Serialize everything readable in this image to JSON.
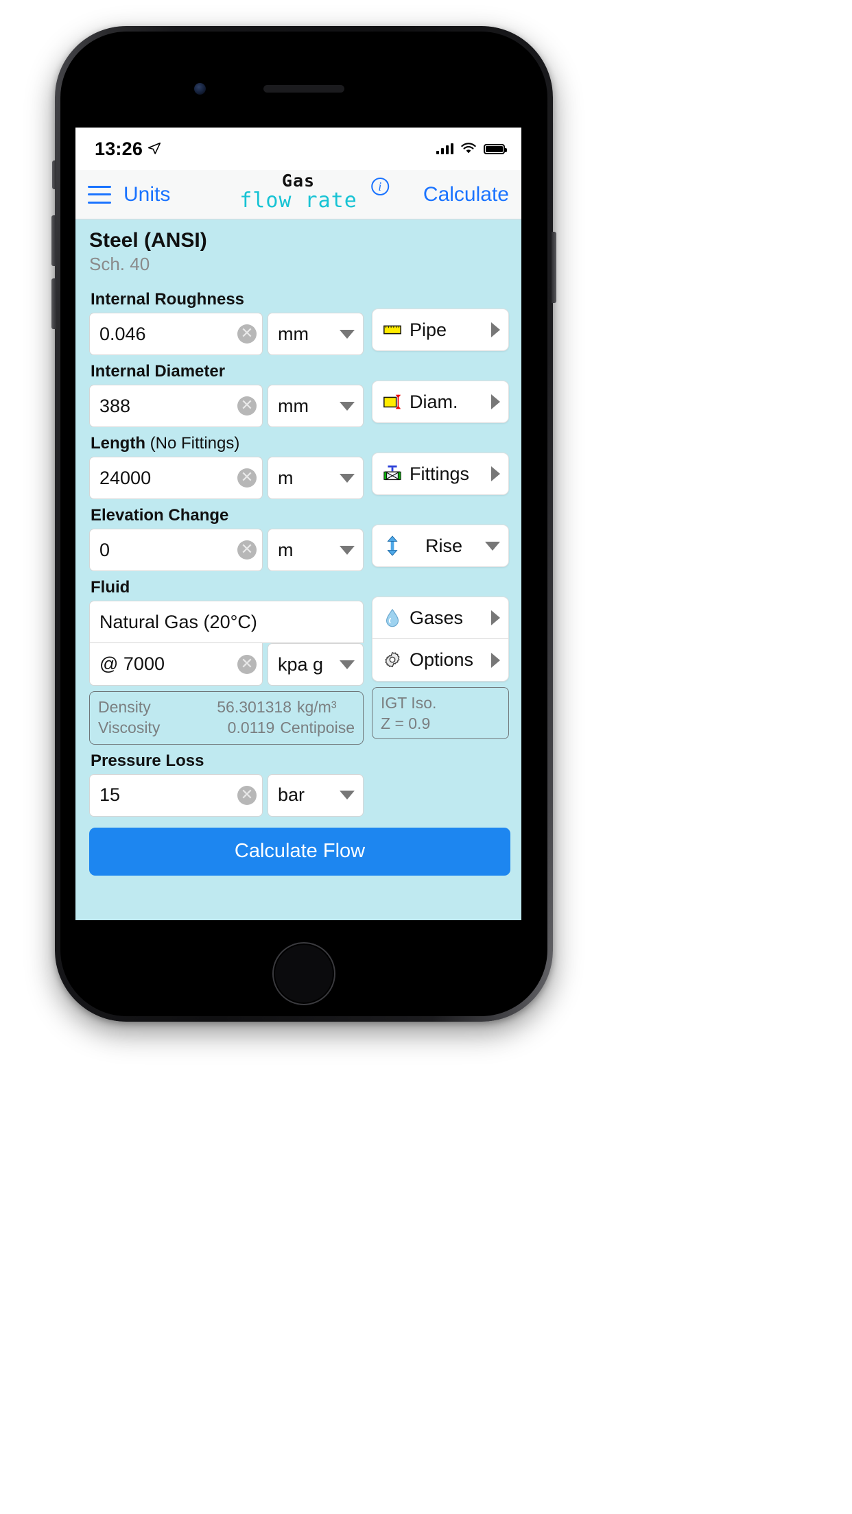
{
  "status_bar": {
    "time": "13:26",
    "location_icon": "location-arrow-icon",
    "signal_icon": "cellular-bars-icon",
    "wifi_icon": "wifi-icon",
    "battery_icon": "battery-full-icon"
  },
  "nav": {
    "menu_icon": "hamburger-menu-icon",
    "units_label": "Units",
    "brand_top": "Gas",
    "brand_bottom": "flow rate",
    "info_icon": "info-circle-icon",
    "info_label": "i",
    "calculate_label": "Calculate"
  },
  "header": {
    "title": "Steel (ANSI)",
    "subtitle": "Sch.  40"
  },
  "fields": {
    "roughness": {
      "label": "Internal Roughness",
      "value": "0.046",
      "unit": "mm"
    },
    "diameter": {
      "label": "Internal Diameter",
      "value": "388",
      "unit": "mm"
    },
    "length": {
      "label": "Length",
      "label_sub": " (No Fittings)",
      "value": "24000",
      "unit": "m"
    },
    "elevation": {
      "label": "Elevation Change",
      "value": "0",
      "unit": "m"
    },
    "fluid": {
      "label": "Fluid",
      "name": "Natural Gas (20°C)",
      "pressure_value": "@ 7000",
      "pressure_unit": "kpa g"
    },
    "pressure_loss": {
      "label": "Pressure Loss",
      "value": "15",
      "unit": "bar"
    }
  },
  "actions": {
    "pipe": {
      "label": "Pipe",
      "icon": "pipe-icon",
      "chevron": "chevron-right-icon"
    },
    "diam": {
      "label": "Diam.",
      "icon": "diameter-icon",
      "chevron": "chevron-right-icon"
    },
    "fittings": {
      "label": "Fittings",
      "icon": "valve-icon",
      "chevron": "chevron-right-icon"
    },
    "rise": {
      "label": "Rise",
      "icon": "up-down-arrow-icon",
      "chevron": "chevron-down-icon"
    },
    "gases": {
      "label": "Gases",
      "icon": "droplet-icon",
      "chevron": "chevron-right-icon"
    },
    "options": {
      "label": "Options",
      "icon": "gear-icon",
      "chevron": "chevron-right-icon"
    }
  },
  "fluid_properties": {
    "density_label": "Density",
    "density_value": "56.301318",
    "density_unit": "kg/m³",
    "viscosity_label": "Viscosity",
    "viscosity_value": "0.0119",
    "viscosity_unit": "Centipoise"
  },
  "iso_box": {
    "line1": "IGT Iso.",
    "line2": "Z = 0.9"
  },
  "calc_button": {
    "label": "Calculate Flow"
  },
  "colors": {
    "accent_blue": "#1a73ff",
    "brand_teal": "#17c3d4",
    "app_background": "#bfe9f0",
    "button_blue": "#1d86f0"
  }
}
